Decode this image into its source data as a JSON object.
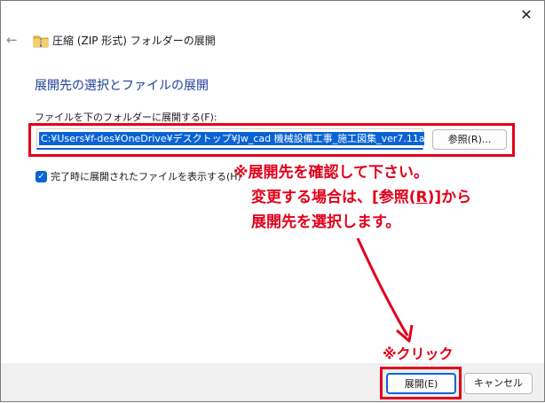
{
  "window": {
    "close_glyph": "✕",
    "back_glyph": "←",
    "title": "圧縮 (ZIP 形式) フォルダーの展開"
  },
  "main": {
    "heading": "展開先の選択とファイルの展開",
    "dest_label": "ファイルを下のフォルダーに展開する(F):",
    "dest_path": "C:¥Users¥f-des¥OneDrive¥デスクトップ¥Jw_cad 機械設備工事_施工図集_ver7.11a",
    "browse_label": "参照(R)...",
    "show_files_label": "完了時に展開されたファイルを表示する(H)",
    "show_files_checked": true
  },
  "annotations": {
    "note_line1": "※展開先を確認して下さい。",
    "note_line2_a": "変更する場合は、[参照(",
    "note_line2_u": "R",
    "note_line2_b": ")]から",
    "note_line3": "展開先を選択します。",
    "click_note": "※クリック",
    "color": "#e2001a"
  },
  "footer": {
    "extract_label": "展開(E)",
    "cancel_label": "キャンセル"
  },
  "colors": {
    "accent": "#0a63d6",
    "heading": "#1f3f9a",
    "footer_bg": "#f0f0f0"
  },
  "icons": {
    "folder": "zip-folder-icon",
    "back": "back-arrow-icon",
    "close": "close-icon"
  }
}
